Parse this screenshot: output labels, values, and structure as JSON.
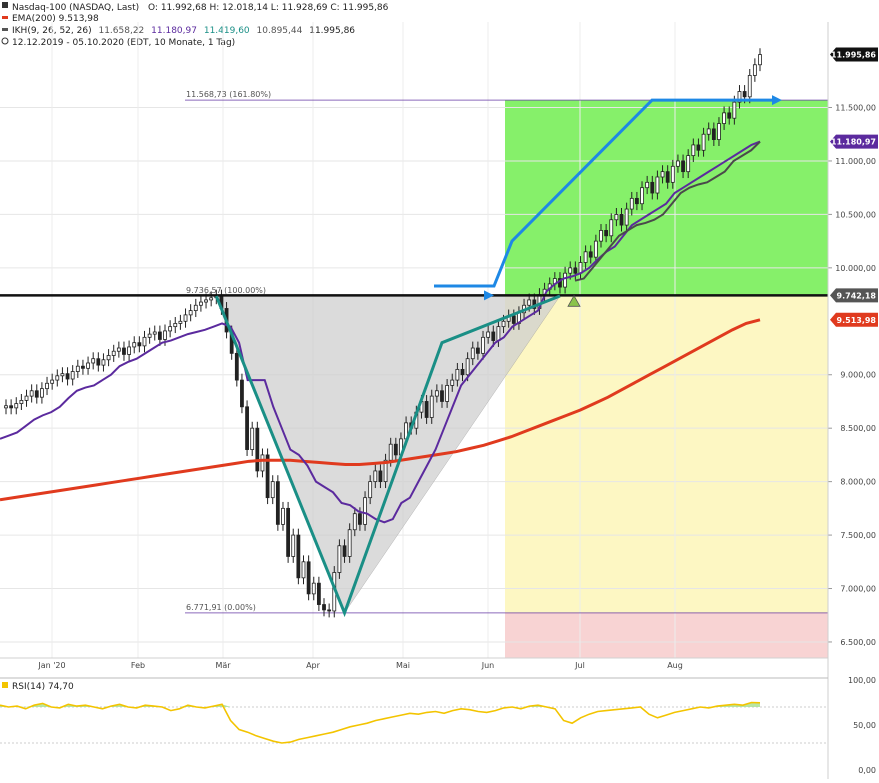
{
  "legend": {
    "instrument": "Nasdaq-100 (NASDAQ, Last)",
    "ohlc": "O: 11.992,68  H: 12.018,14  L: 11.928,69  C: 11.995,86",
    "ema": "EMA(200)  9.513,98",
    "ikh_label": "IKH(9, 26, 52, 26)",
    "ikh_values": [
      "11.658,22",
      "11.180,97",
      "11.419,60",
      "10.895,44",
      "11.995,86"
    ],
    "range": "12.12.2019 - 05.10.2020  (EDT, 10 Monate, 1 Tag)"
  },
  "colors": {
    "ema": "#e03a1e",
    "ikh": "#5b2a9e",
    "ikh2": "#4a4a4a",
    "candle_up": "#ffffff",
    "candle_down": "#222222",
    "trend": "#1a8f86",
    "arrow": "#1e88e5",
    "green_zone": "#86f06a",
    "yellow_zone": "#fdf7c3",
    "red_zone": "#f8d3d3",
    "rsi": "#f3c400",
    "black_line": "#111111"
  },
  "chart_data": [
    {
      "type": "candlestick",
      "name": "Nasdaq-100",
      "x_ticks": [
        "Jan '20",
        "Feb",
        "Mär",
        "Apr",
        "Mai",
        "Jun",
        "Jul",
        "Aug"
      ],
      "y_ticks": [
        "11.500,00",
        "11.000,00",
        "10.500,00",
        "10.000,00",
        "9.000,00",
        "8.500,00",
        "8.000,00",
        "7.500,00",
        "7.000,00",
        "6.500,00"
      ],
      "y_tick_values": [
        11500,
        11000,
        10500,
        10000,
        9000,
        8500,
        8000,
        7500,
        7000,
        6500
      ],
      "ylim": [
        6350,
        12300
      ],
      "price_labels": [
        {
          "text": "11.995,86",
          "value": 11995.86,
          "color": "#111111"
        },
        {
          "text": "11.180,97",
          "value": 11180.97,
          "color": "#5b2a9e"
        },
        {
          "text": "9.742,18",
          "value": 9742.18,
          "color": "#555555"
        },
        {
          "text": "9.513,98",
          "value": 9513.98,
          "color": "#e03a1e"
        }
      ],
      "annotations": [
        {
          "text": "11.568,73 (161.80%)",
          "value": 11568.73
        },
        {
          "text": "9.736,57 (100.00%)",
          "value": 9736.57
        },
        {
          "text": "6.771,91 (0.00%)",
          "value": 6771.91
        }
      ],
      "support_level": 9742.18,
      "close_series": [
        8710,
        8690,
        8730,
        8760,
        8800,
        8850,
        8790,
        8870,
        8920,
        8950,
        8990,
        9010,
        8960,
        9030,
        9080,
        9060,
        9110,
        9150,
        9090,
        9140,
        9180,
        9220,
        9250,
        9190,
        9260,
        9300,
        9270,
        9350,
        9380,
        9400,
        9330,
        9410,
        9450,
        9480,
        9500,
        9560,
        9600,
        9650,
        9680,
        9700,
        9720,
        9736,
        9620,
        9400,
        9200,
        8950,
        8700,
        8300,
        8500,
        8100,
        8250,
        7850,
        8000,
        7600,
        7750,
        7300,
        7500,
        7100,
        7250,
        6950,
        7050,
        6850,
        6800,
        6790,
        7150,
        7400,
        7300,
        7550,
        7700,
        7600,
        7850,
        8000,
        8100,
        8000,
        8200,
        8350,
        8250,
        8400,
        8550,
        8500,
        8650,
        8750,
        8600,
        8800,
        8850,
        8750,
        8900,
        8950,
        9050,
        9000,
        9150,
        9250,
        9200,
        9350,
        9400,
        9320,
        9450,
        9500,
        9550,
        9480,
        9580,
        9650,
        9700,
        9620,
        9750,
        9800,
        9850,
        9900,
        9820,
        9950,
        10000,
        9950,
        10050,
        10150,
        10100,
        10250,
        10350,
        10300,
        10450,
        10500,
        10400,
        10550,
        10650,
        10600,
        10750,
        10800,
        10700,
        10850,
        10900,
        10800,
        10950,
        11000,
        10900,
        11050,
        11150,
        11100,
        11250,
        11300,
        11200,
        11350,
        11450,
        11400,
        11550,
        11650,
        11600,
        11800,
        11900,
        11995
      ],
      "ema200_series": [
        7830,
        7850,
        7870,
        7890,
        7910,
        7930,
        7950,
        7970,
        7990,
        8010,
        8030,
        8050,
        8070,
        8090,
        8110,
        8130,
        8150,
        8170,
        8190,
        8200,
        8200,
        8200,
        8190,
        8180,
        8170,
        8160,
        8160,
        8170,
        8180,
        8200,
        8220,
        8240,
        8260,
        8280,
        8310,
        8340,
        8380,
        8420,
        8470,
        8520,
        8570,
        8620,
        8670,
        8730,
        8790,
        8860,
        8930,
        9000,
        9070,
        9140,
        9210,
        9280,
        9350,
        9420,
        9480,
        9514
      ],
      "ikh_series": [
        8400,
        8430,
        8460,
        8520,
        8580,
        8620,
        8650,
        8700,
        8780,
        8850,
        8880,
        8900,
        8950,
        9000,
        9080,
        9120,
        9150,
        9200,
        9250,
        9300,
        9320,
        9350,
        9380,
        9400,
        9420,
        9450,
        9480,
        9450,
        9300,
        8950,
        8950,
        8950,
        8700,
        8500,
        8300,
        8250,
        8150,
        8000,
        7950,
        7900,
        7800,
        7780,
        7720,
        7700,
        7650,
        7620,
        7650,
        7800,
        7850,
        8000,
        8150,
        8300,
        8500,
        8700,
        8900,
        9000,
        9100,
        9200,
        9300,
        9350,
        9450,
        9500,
        9550,
        9600,
        9780,
        9850,
        9900,
        9920,
        9950,
        10000,
        10080,
        10150,
        10200,
        10300,
        10400,
        10450,
        10500,
        10550,
        10600,
        10700,
        10750,
        10800,
        10850,
        10900,
        10950,
        11000,
        11050,
        11100,
        11150,
        11181
      ],
      "rsi": {
        "label": "RSI(14)  74,70",
        "value": 74.7,
        "y_ticks": [
          "100,00",
          "50,00",
          "0,00"
        ],
        "series": [
          72,
          70,
          71,
          68,
          72,
          74,
          70,
          69,
          73,
          71,
          72,
          70,
          68,
          71,
          73,
          70,
          69,
          72,
          71,
          70,
          66,
          68,
          72,
          70,
          69,
          71,
          73,
          55,
          45,
          42,
          38,
          35,
          32,
          30,
          31,
          34,
          36,
          38,
          40,
          42,
          45,
          48,
          50,
          52,
          55,
          57,
          59,
          61,
          63,
          62,
          64,
          65,
          63,
          66,
          68,
          67,
          65,
          64,
          66,
          69,
          70,
          68,
          71,
          72,
          70,
          68,
          55,
          52,
          58,
          62,
          65,
          66,
          67,
          68,
          69,
          70,
          62,
          58,
          61,
          64,
          66,
          68,
          70,
          69,
          71,
          72,
          73,
          72,
          75,
          74.7
        ]
      }
    }
  ]
}
